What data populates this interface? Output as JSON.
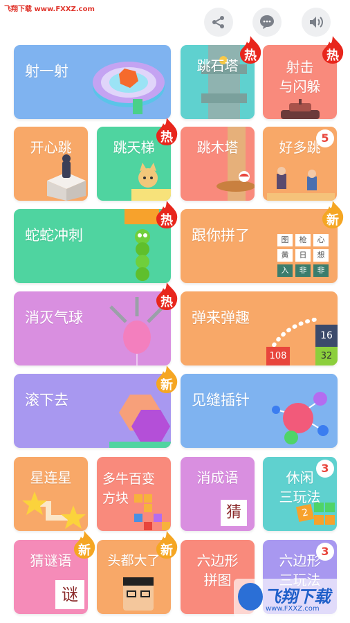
{
  "watermark_top": "飞翔下载 www.FXXZ.com",
  "toolbar": {
    "share_icon": "share-icon",
    "feedback_icon": "chat-bubble-icon",
    "sound_icon": "speaker-icon"
  },
  "games": [
    {
      "label": "射一射",
      "badge": ""
    },
    {
      "label": "跳石塔",
      "badge": "热"
    },
    {
      "label": "射击\n与闪躲",
      "badge": "热"
    },
    {
      "label": "开心跳",
      "badge": ""
    },
    {
      "label": "跳天梯",
      "badge": "热"
    },
    {
      "label": "跳木塔",
      "badge": ""
    },
    {
      "label": "好多跳",
      "count": "5"
    },
    {
      "label": "蛇蛇冲刺",
      "badge": "热"
    },
    {
      "label": "跟你拼了",
      "badge": "新"
    },
    {
      "label": "消灭气球",
      "badge": "热"
    },
    {
      "label": "弹来弹趣",
      "badge": ""
    },
    {
      "label": "滚下去",
      "badge": "新"
    },
    {
      "label": "见缝插针",
      "badge": ""
    },
    {
      "label": "星连星",
      "badge": ""
    },
    {
      "label": "多牛百变\n方块",
      "badge": ""
    },
    {
      "label": "消成语",
      "badge": ""
    },
    {
      "label": "休闲\n三玩法",
      "count": "3"
    },
    {
      "label": "猜谜语",
      "badge": "新"
    },
    {
      "label": "头都大了",
      "badge": "新"
    },
    {
      "label": "六边形\n拼图",
      "badge": ""
    },
    {
      "label": "六边形\n三玩法",
      "count": "3"
    }
  ],
  "art_text": {
    "crossword": [
      "图",
      "枪",
      "心",
      "黄",
      "日",
      "想",
      "入",
      "非",
      "非"
    ],
    "bounce_numbers": [
      "16",
      "108",
      "32"
    ],
    "idiom_char": "猜",
    "riddle_char": "谜",
    "puzzle_num": "2"
  },
  "watermark_bottom": {
    "brand": "飞翔下载",
    "url": "www.FXXZ.com"
  },
  "colors": {
    "blue": "#7fb3f0",
    "teal": "#5fd1cf",
    "salmon": "#f98a7c",
    "orange": "#f8a868",
    "green": "#4fd4a0",
    "purple": "#d98fe0",
    "violet": "#a898f0",
    "pink": "#f58bb8",
    "hot": "#e8261c",
    "new": "#f5a623"
  }
}
